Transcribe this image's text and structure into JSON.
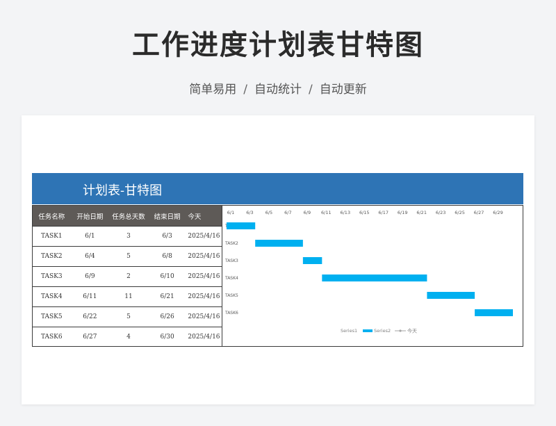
{
  "page": {
    "title": "工作进度计划表甘特图",
    "subtitle_items": [
      "简单易用",
      "自动统计",
      "自动更新"
    ],
    "separator": "/"
  },
  "sheet": {
    "title": "计划表-甘特图",
    "header_color": "#2e74b5"
  },
  "table": {
    "headers": [
      "任务名称",
      "开始日期",
      "任务总天数",
      "结束日期",
      "今天"
    ],
    "rows": [
      [
        "TASK1",
        "6/1",
        "3",
        "6/3",
        "2025/4/16"
      ],
      [
        "TASK2",
        "6/4",
        "5",
        "6/8",
        "2025/4/16"
      ],
      [
        "TASK3",
        "6/9",
        "2",
        "6/10",
        "2025/4/16"
      ],
      [
        "TASK4",
        "6/11",
        "11",
        "6/21",
        "2025/4/16"
      ],
      [
        "TASK5",
        "6/22",
        "5",
        "6/26",
        "2025/4/16"
      ],
      [
        "TASK6",
        "6/27",
        "4",
        "6/30",
        "2025/4/16"
      ]
    ]
  },
  "chart_data": {
    "type": "bar",
    "orientation": "horizontal-stacked",
    "categories": [
      "TASK1",
      "TASK2",
      "TASK3",
      "TASK4",
      "TASK5",
      "TASK6"
    ],
    "x_tick_labels": [
      "6/1",
      "6/3",
      "6/5",
      "6/7",
      "6/9",
      "6/11",
      "6/13",
      "6/15",
      "6/17",
      "6/19",
      "6/21",
      "6/23",
      "6/25",
      "6/27",
      "6/29"
    ],
    "x_range_days": [
      1,
      31
    ],
    "series": [
      {
        "name": "Series1",
        "start_day": [
          1,
          4,
          9,
          11,
          22,
          27
        ],
        "color": "none"
      },
      {
        "name": "Series2",
        "duration_days": [
          3,
          5,
          2,
          11,
          5,
          4
        ],
        "color": "#00b0f0"
      }
    ],
    "legend": {
      "position": "bottom",
      "entries": [
        "Series1",
        "Series2",
        "今天"
      ],
      "today_color": "#a6a6a6"
    },
    "grid": false
  }
}
